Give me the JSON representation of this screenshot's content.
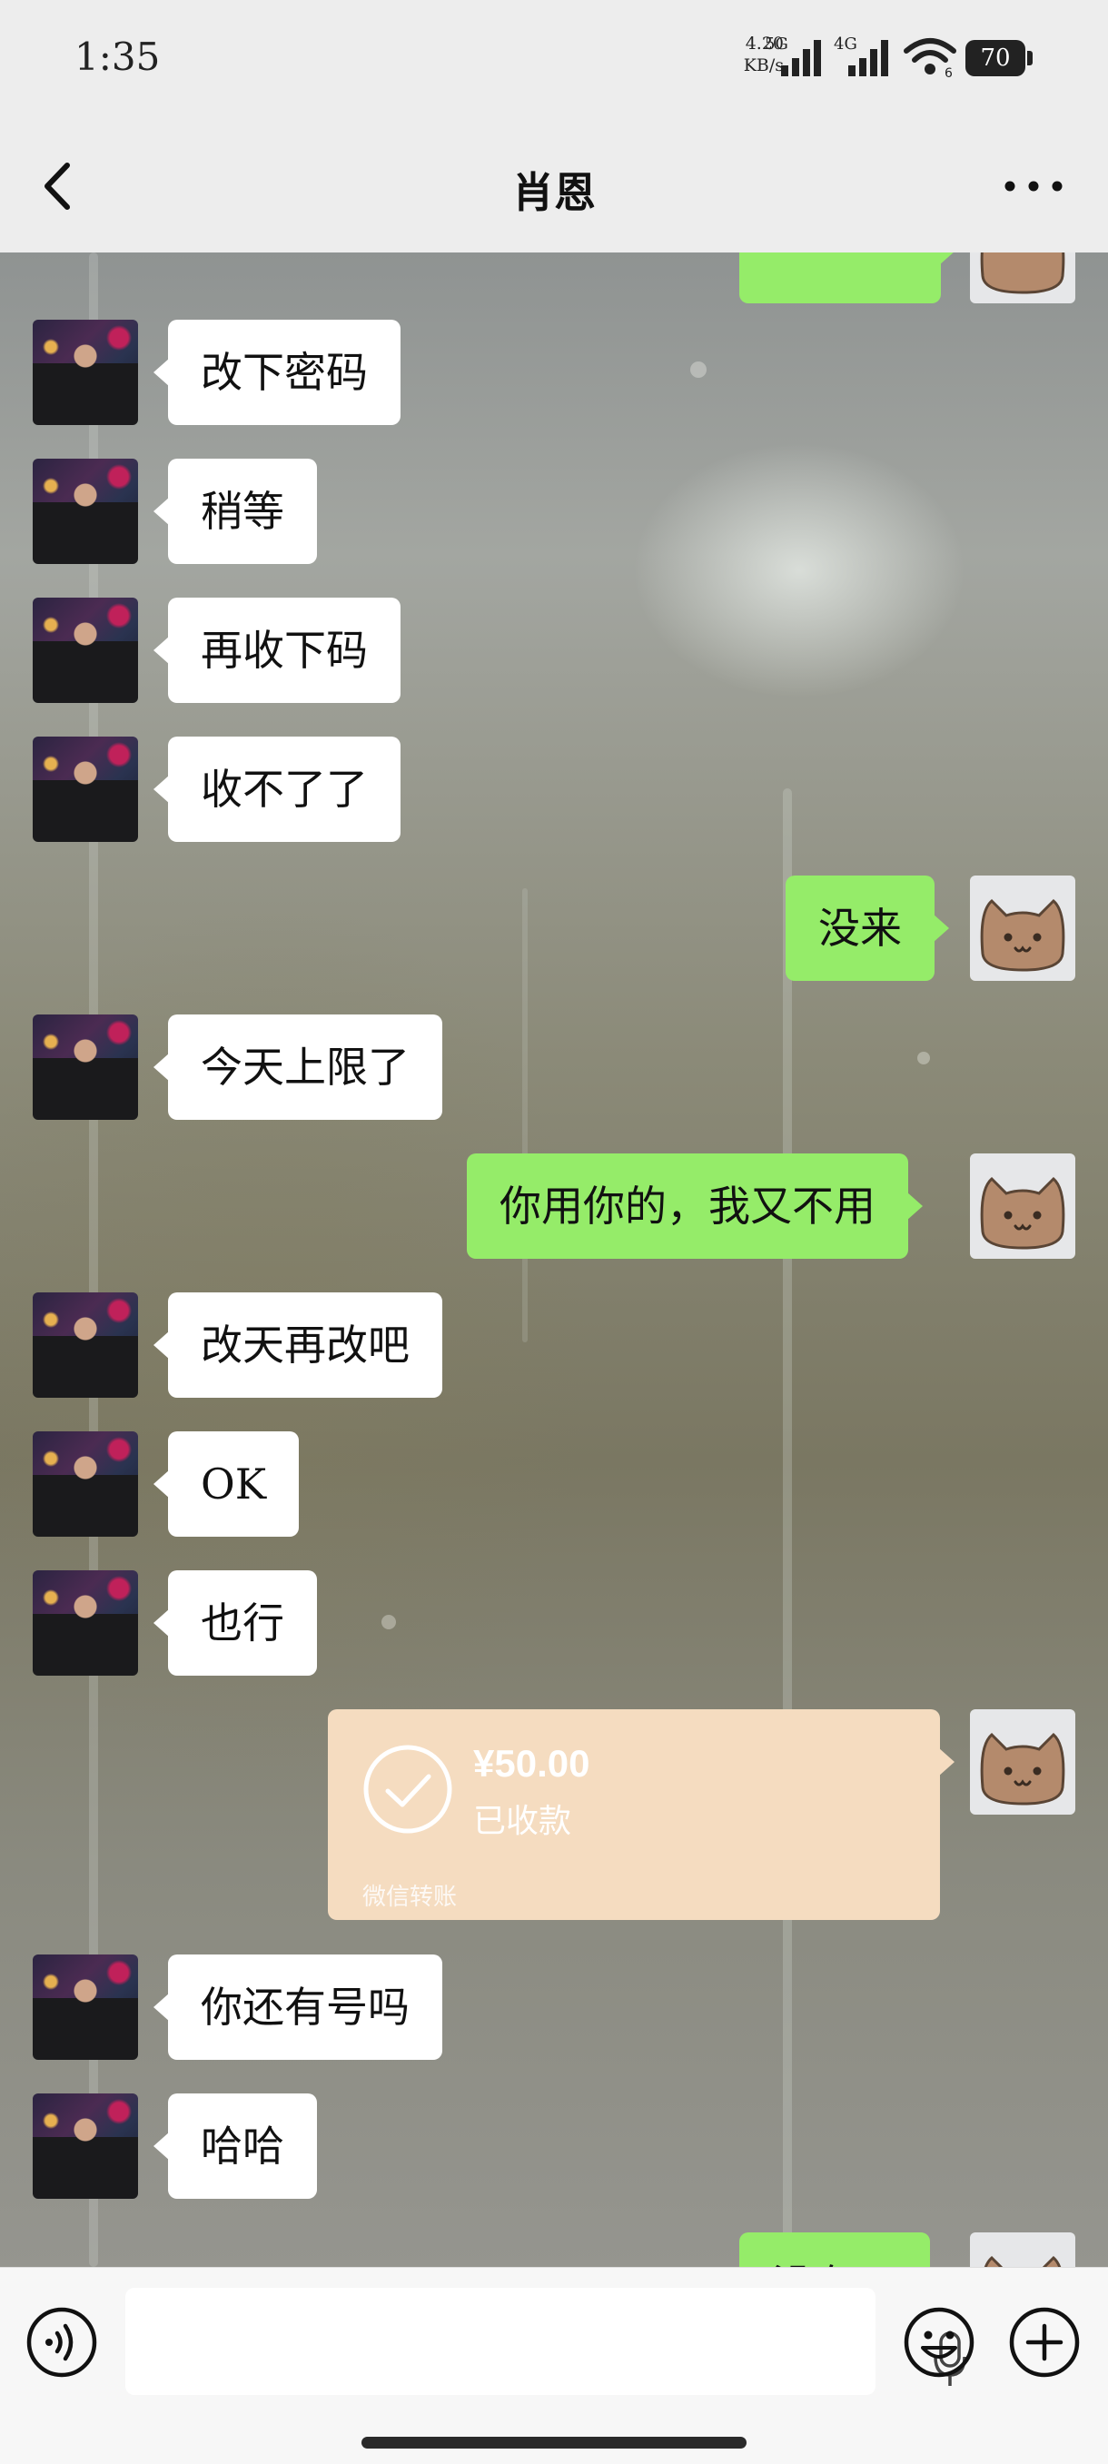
{
  "status_bar": {
    "time": "1:35",
    "net_speed_value": "4.20",
    "net_speed_unit": "KB/s",
    "network_5g": "5G",
    "network_4g": "4G",
    "wifi_level": "6",
    "battery": "70"
  },
  "header": {
    "title": "肖恩",
    "back_icon": "chevron-left-icon",
    "more_icon": "more-dots-icon"
  },
  "messages": [
    {
      "from": "other",
      "text": "改下密码"
    },
    {
      "from": "other",
      "text": "稍等"
    },
    {
      "from": "other",
      "text": "再收下码"
    },
    {
      "from": "other",
      "text": "收不了了"
    },
    {
      "from": "self",
      "text": "没来"
    },
    {
      "from": "other",
      "text": "今天上限了"
    },
    {
      "from": "self",
      "text": "你用你的，我又不用"
    },
    {
      "from": "other",
      "text": "改天再改吧"
    },
    {
      "from": "other",
      "text": "OK"
    },
    {
      "from": "other",
      "text": "也行"
    },
    {
      "from": "self",
      "type": "transfer",
      "amount": "¥50.00",
      "status": "已收款",
      "label": "微信转账"
    },
    {
      "from": "other",
      "text": "你还有号吗"
    },
    {
      "from": "other",
      "text": "哈哈"
    },
    {
      "from": "self",
      "text": "没有了"
    }
  ],
  "input_bar": {
    "voice_icon": "voice-mode-icon",
    "mic_icon": "microphone-icon",
    "emoji_icon": "emoji-icon",
    "plus_icon": "plus-circle-icon"
  },
  "colors": {
    "incoming_bubble": "#ffffff",
    "outgoing_bubble": "#95ec69",
    "transfer_card": "#f5dcc0",
    "header_bg": "#ededed"
  }
}
